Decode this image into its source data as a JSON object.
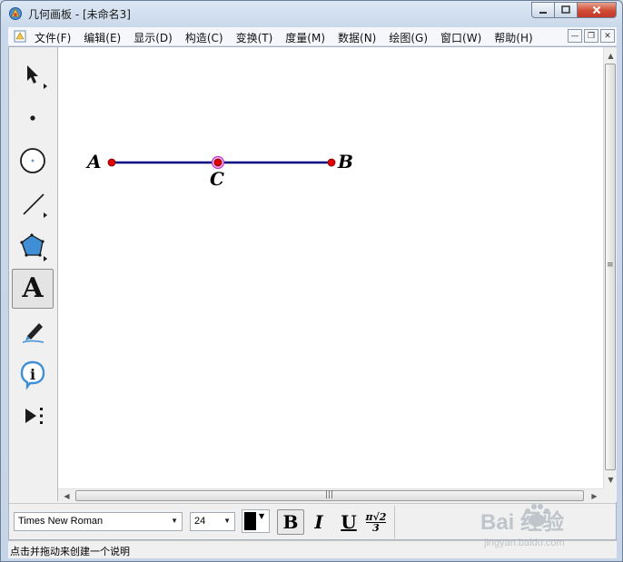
{
  "window": {
    "title": "几何画板 - [未命名3]"
  },
  "menu": {
    "items": [
      "文件(F)",
      "编辑(E)",
      "显示(D)",
      "构造(C)",
      "变换(T)",
      "度量(M)",
      "数据(N)",
      "绘图(G)",
      "窗口(W)",
      "帮助(H)"
    ]
  },
  "toolbox": {
    "tools": [
      {
        "name": "selection-arrow-tool",
        "active": false
      },
      {
        "name": "point-tool",
        "active": false
      },
      {
        "name": "compass-tool",
        "active": false
      },
      {
        "name": "straightedge-tool",
        "active": false
      },
      {
        "name": "polygon-tool",
        "active": false
      },
      {
        "name": "text-tool",
        "active": true,
        "glyph": "A"
      },
      {
        "name": "marker-tool",
        "active": false
      },
      {
        "name": "information-tool",
        "active": false
      },
      {
        "name": "custom-tools-tool",
        "active": false
      }
    ]
  },
  "canvas": {
    "points": [
      {
        "label": "A",
        "color": "#e00000"
      },
      {
        "label": "C",
        "color": "#e00000",
        "selected": true,
        "highlight": "#cc33cc"
      },
      {
        "label": "B",
        "color": "#e00000"
      }
    ],
    "segment_color": "#000080"
  },
  "textbar": {
    "font": "Times New Roman",
    "size": "24",
    "color": "#000000",
    "bold_label": "B",
    "italic_label": "I",
    "underline_label": "U",
    "math_top": "π√2",
    "math_bottom": "3"
  },
  "status": {
    "text": "点击并拖动来创建一个说明"
  },
  "watermark": {
    "brand": "Bai 经验",
    "sub": "jingyan.baidu.com"
  }
}
